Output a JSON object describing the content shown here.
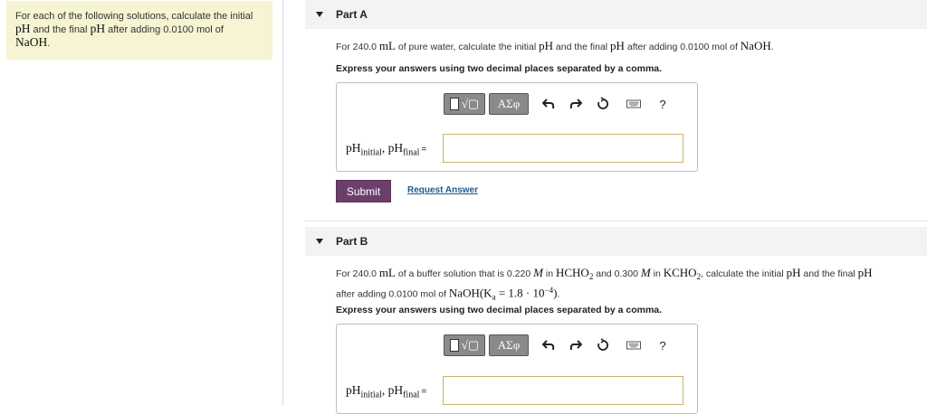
{
  "intro": {
    "line1": "For each of the following solutions, calculate the initial",
    "ph1": "pH",
    "line2": " and the final ",
    "ph2": "pH",
    "line3": " after adding 0.0100 mol of",
    "naoh": "NaOH",
    "end": "."
  },
  "partA": {
    "title": "Part A",
    "q_pre": "For 240.0 ",
    "q_ml": "mL",
    "q_mid": " of pure water, calculate the initial ",
    "q_ph1": "pH",
    "q_mid2": " and the final ",
    "q_ph2": "pH",
    "q_mid3": " after adding 0.0100 mol of ",
    "q_naoh": "NaOH",
    "q_end": ".",
    "instruction": "Express your answers using two decimal places separated by a comma.",
    "label_ph": "pH",
    "label_initial": "initial",
    "label_comma": ", ",
    "label_ph2": "pH",
    "label_final": "final",
    "label_eq": "=",
    "answer_value": "",
    "submit": "Submit",
    "request": "Request Answer"
  },
  "partB": {
    "title": "Part B",
    "q_pre": "For 240.0 ",
    "q_ml": "mL",
    "q_a": " of a buffer solution that is 0.220 ",
    "q_M1": "M",
    "q_b": " in ",
    "q_hcho": "HCHO",
    "q_sub2a": "2",
    "q_c": " and 0.300 ",
    "q_M2": "M",
    "q_d": " in ",
    "q_kcho": "KCHO",
    "q_sub2b": "2",
    "q_e": ", calculate the initial ",
    "q_ph1": "pH",
    "q_f": " and the final ",
    "q_ph2": "pH",
    "q_line2a": "after adding 0.0100 mol of ",
    "q_naoh": "NaOH(K",
    "q_ka_sub": "a",
    "q_kaval": " = 1.8 · 10",
    "q_exp": "−4",
    "q_close": ")",
    "q_end": ".",
    "instruction": "Express your answers using two decimal places separated by a comma.",
    "label_ph": "pH",
    "label_initial": "initial",
    "label_comma": ", ",
    "label_ph2": "pH",
    "label_final": "final",
    "label_eq": "=",
    "answer_value": ""
  },
  "toolbar": {
    "greek": "ΑΣφ",
    "radical": "√▢",
    "help": "?",
    "icons": [
      "templates-icon",
      "greek-symbols-icon",
      "undo-icon",
      "redo-icon",
      "reset-icon",
      "keyboard-icon",
      "help-icon"
    ]
  }
}
